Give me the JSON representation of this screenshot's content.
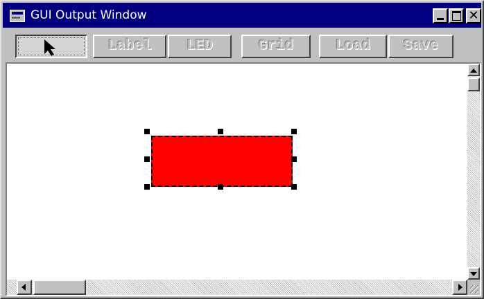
{
  "window": {
    "title": "GUI Output Window",
    "icon": "app-window-icon",
    "caption_buttons": [
      "minimize-icon",
      "maximize-icon",
      "close-icon"
    ],
    "close_glyph": "✕"
  },
  "toolbar": {
    "pointer_icon": "cursor-arrow-icon",
    "buttons": [
      {
        "label": "Label"
      },
      {
        "label": "LED"
      },
      {
        "label": "Grid"
      },
      {
        "label": "Load"
      },
      {
        "label": "Save"
      }
    ]
  },
  "canvas": {
    "background": "#ffffff",
    "selected_shape": {
      "type": "rectangle",
      "fill": "#ff0000",
      "selected": true
    }
  },
  "colors": {
    "titlebar": "#000080",
    "face": "#c0c0c0"
  }
}
